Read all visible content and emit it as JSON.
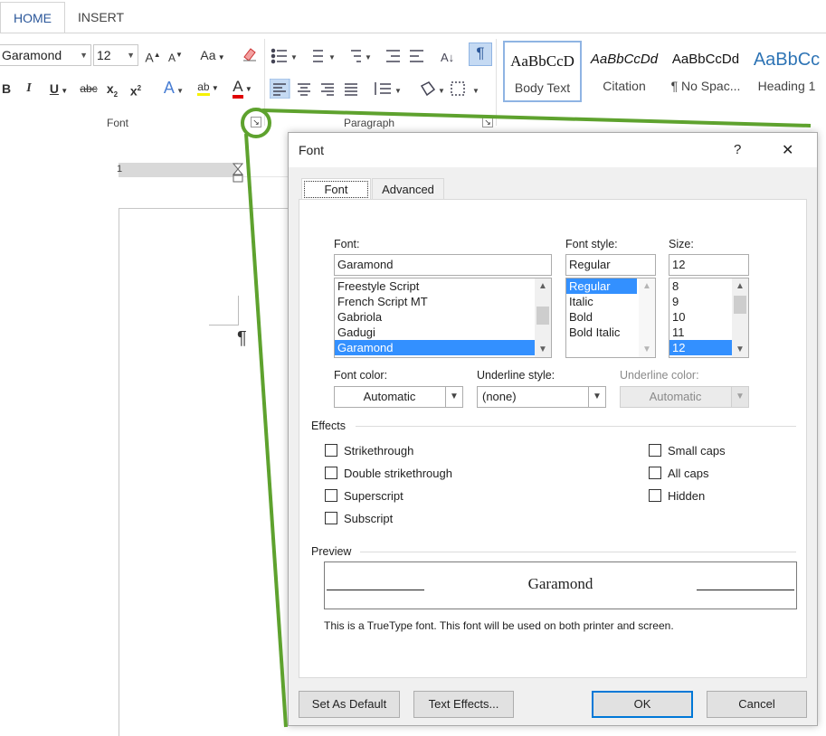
{
  "ribbon": {
    "tabs": [
      {
        "label": "HOME",
        "active": true
      },
      {
        "label": "INSERT",
        "active": false
      }
    ],
    "font_name": "Garamond",
    "font_size": "12",
    "font_group_label": "Font",
    "paragraph_group_label": "Paragraph",
    "buttons": {
      "grow": "A",
      "shrink": "A",
      "change_case": "Aa",
      "bold": "B",
      "italic": "I",
      "underline": "U",
      "strikethrough": "abc",
      "subscript": "x",
      "superscript": "x",
      "text_effects": "A",
      "highlight": "ab",
      "font_color": "A",
      "show_marks": "¶"
    },
    "styles": [
      {
        "preview": "AaBbCcD",
        "name": "Body Text"
      },
      {
        "preview": "AaBbCcDd",
        "name": "Citation"
      },
      {
        "preview": "AaBbCcDd",
        "name": "¶ No Spac..."
      },
      {
        "preview": "AaBbCc",
        "name": "Heading 1"
      }
    ],
    "accent_color": "#2b579a",
    "font_color_bar": "#e00000"
  },
  "document": {
    "pilcrow": "¶",
    "ruler_mark": "1"
  },
  "dialog": {
    "title": "Font",
    "help": "?",
    "close": "✕",
    "tabs": {
      "font": "Font",
      "advanced": "Advanced"
    },
    "font_label": "Font:",
    "font_value": "Garamond",
    "font_list": [
      "Freestyle Script",
      "French Script MT",
      "Gabriola",
      "Gadugi",
      "Garamond"
    ],
    "font_list_selected": 4,
    "style_label": "Font style:",
    "style_value": "Regular",
    "style_list": [
      "Regular",
      "Italic",
      "Bold",
      "Bold Italic"
    ],
    "style_list_selected": 0,
    "size_label": "Size:",
    "size_value": "12",
    "size_list": [
      "8",
      "9",
      "10",
      "11",
      "12"
    ],
    "size_list_selected": 4,
    "font_color_label": "Font color:",
    "font_color_value": "Automatic",
    "underline_style_label": "Underline style:",
    "underline_style_value": "(none)",
    "underline_color_label": "Underline color:",
    "underline_color_value": "Automatic",
    "effects_label": "Effects",
    "effects_left": [
      {
        "label": "Strikethrough",
        "checked": false
      },
      {
        "label": "Double strikethrough",
        "checked": false
      },
      {
        "label": "Superscript",
        "checked": false
      },
      {
        "label": "Subscript",
        "checked": false
      }
    ],
    "effects_right": [
      {
        "label": "Small caps",
        "checked": false
      },
      {
        "label": "All caps",
        "checked": false
      },
      {
        "label": "Hidden",
        "checked": false
      }
    ],
    "preview_label": "Preview",
    "preview_text": "Garamond",
    "preview_note": "This is a TrueType font. This font will be used on both printer and screen.",
    "buttons": {
      "set_default": "Set As Default",
      "text_effects": "Text Effects...",
      "ok": "OK",
      "cancel": "Cancel"
    },
    "selection_color": "#3390ff"
  },
  "callout_color": "#5ea22e"
}
